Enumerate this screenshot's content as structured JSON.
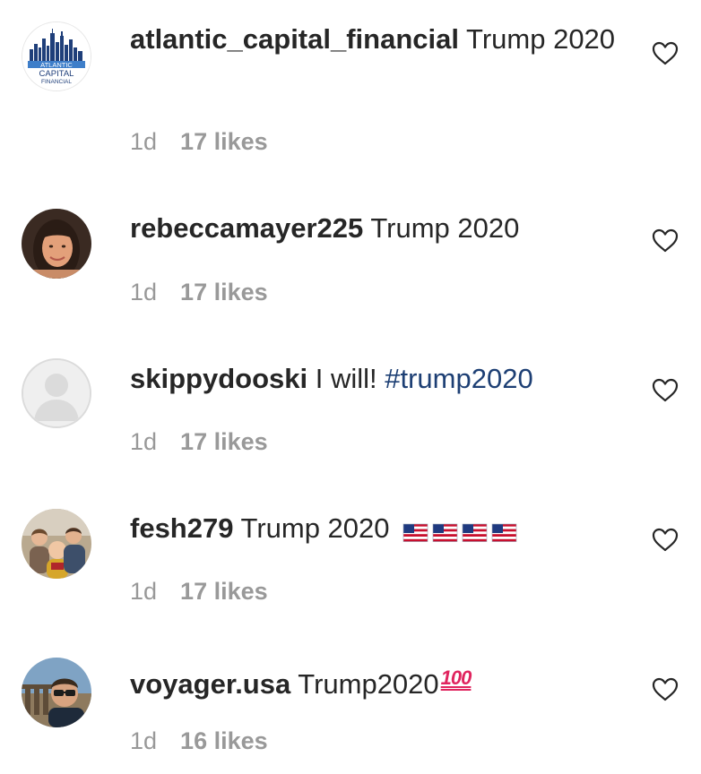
{
  "comments": [
    {
      "username": "atlantic_capital_financial",
      "text": "Trump 2020",
      "time": "1d",
      "likes": "17 likes",
      "avatar": {
        "type": "logo",
        "line1": "ATLANTIC",
        "line2": "CAPITAL",
        "line3": "FINANCIAL"
      },
      "heart_icon": "heart-outline-icon"
    },
    {
      "username": "rebeccamayer225",
      "text": "Trump 2020",
      "time": "1d",
      "likes": "17 likes",
      "avatar": {
        "type": "photo-portrait"
      },
      "heart_icon": "heart-outline-icon"
    },
    {
      "username": "skippydooski",
      "text": "I will! ",
      "hashtag": "#trump2020",
      "time": "1d",
      "likes": "17 likes",
      "avatar": {
        "type": "default-placeholder"
      },
      "heart_icon": "heart-outline-icon"
    },
    {
      "username": "fesh279",
      "text": "Trump 2020 ",
      "emojis": [
        "us-flag",
        "us-flag",
        "us-flag",
        "us-flag"
      ],
      "time": "1d",
      "likes": "17 likes",
      "avatar": {
        "type": "photo-family"
      },
      "heart_icon": "heart-outline-icon"
    },
    {
      "username": "voyager.usa",
      "text": "Trump2020",
      "emoji_hundred": "100",
      "time": "1d",
      "likes": "16 likes",
      "avatar": {
        "type": "photo-selfie"
      },
      "heart_icon": "heart-outline-icon"
    }
  ],
  "colors": {
    "text": "#262626",
    "meta": "#999999",
    "hashtag": "#1d3f74",
    "logo_blue": "#2a4a8c",
    "logo_light_blue": "#3e7ec9",
    "hundred_red": "#e0245e"
  }
}
